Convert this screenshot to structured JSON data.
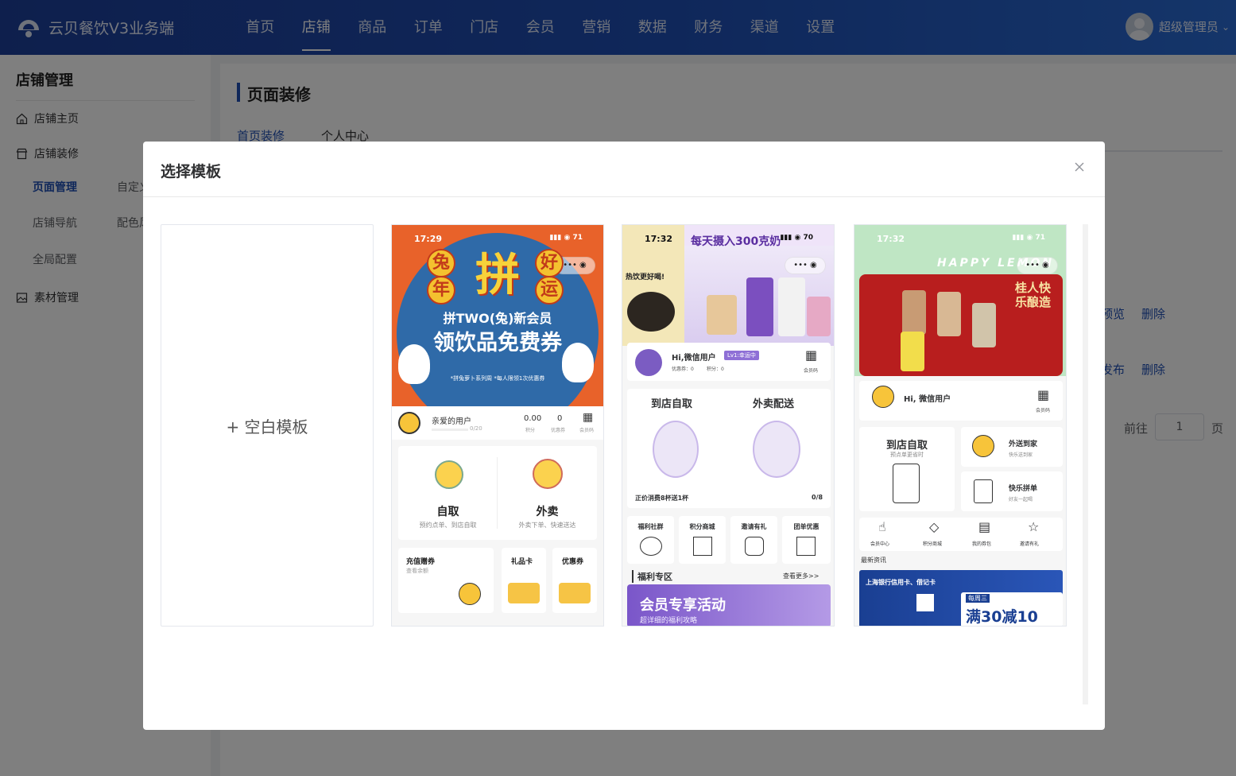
{
  "app": {
    "title": "云贝餐饮V3业务端"
  },
  "nav": {
    "items": [
      "首页",
      "店铺",
      "商品",
      "订单",
      "门店",
      "会员",
      "营销",
      "数据",
      "财务",
      "渠道",
      "设置"
    ],
    "active": "店铺"
  },
  "user": {
    "name": "超级管理员"
  },
  "sidebar": {
    "title": "店铺管理",
    "groups": {
      "home": "店铺主页",
      "decor": "店铺装修",
      "material": "素材管理"
    },
    "subs": {
      "page_mgmt": "页面管理",
      "nav": "店铺导航",
      "global": "全局配置",
      "custom": "自定义",
      "color": "配色风格"
    }
  },
  "page": {
    "title": "页面装修",
    "tabs": [
      "首页装修",
      "个人中心"
    ],
    "row_actions": {
      "preview": "预览",
      "delete1": "删除",
      "publish": "发布",
      "delete2": "删除"
    },
    "pagination": {
      "goto": "前往",
      "page_value": "1",
      "page_suffix": "页"
    }
  },
  "modal": {
    "title": "选择模板",
    "blank_label": "+ 空白模板",
    "templates": [
      {
        "time": "17:29",
        "battery": "71",
        "hero_chars": [
          "兔",
          "年",
          "拼",
          "好",
          "运"
        ],
        "hero_line1": "拼TWO(兔)新会员",
        "hero_line2": "领饮品免费券",
        "hero_note": "*拼兔萝卜系列周 *每人限领1次优惠券",
        "user_label": "亲爱的用户",
        "user_progress": "0/20",
        "points": "0.00",
        "points_label": "积分",
        "coupons": "0",
        "coupons_label": "优惠券",
        "code_label": "会员码",
        "left_title": "自取",
        "left_sub": "预约点单、到店自取",
        "right_title": "外卖",
        "right_sub": "外卖下单、快速送达",
        "b1_title": "充值赠券",
        "b1_sub": "查看余额",
        "b2_title": "礼品卡",
        "b3_title": "优惠券"
      },
      {
        "time": "17:32",
        "battery": "70",
        "headline": "每天摄入300克奶",
        "side_text": "热饮更好喝!",
        "user": "Hi,微信用户",
        "level": "Lv1:幸运中",
        "balance": "优惠券：0",
        "points": "积分：0",
        "code_label": "会员码",
        "left_title": "到店自取",
        "right_title": "外卖配送",
        "promo": "正价消费8杯送1杯",
        "promo_count": "0/8",
        "icons": [
          "福利社群",
          "积分商城",
          "邀请有礼",
          "团单优惠"
        ],
        "section": "福利专区",
        "more": "查看更多>>",
        "banner_title": "会员专享活动",
        "banner_sub": "超详细的福利攻略"
      },
      {
        "time": "17:32",
        "battery": "71",
        "brand": "HAPPY LEMON",
        "vertical_text": "桂人快乐酿造",
        "user": "Hi, 微信用户",
        "code_label": "会员码",
        "left_title": "到店自取",
        "left_sub": "预点单更省时",
        "r1_title": "外送到家",
        "r1_sub": "快乐送到家",
        "r2_title": "快乐拼单",
        "r2_sub": "好友一起喝",
        "icons": [
          "会员中心",
          "积分商城",
          "我的券包",
          "邀请有礼"
        ],
        "news": "最新资讯",
        "bank": "上海银行信用卡、借记卡",
        "deal": "满30减10",
        "weekday": "每周三"
      }
    ]
  },
  "colors": {
    "primary": "#1f4fb5",
    "accent_orange": "#e8622a",
    "lemon_red": "#b81e1e"
  }
}
